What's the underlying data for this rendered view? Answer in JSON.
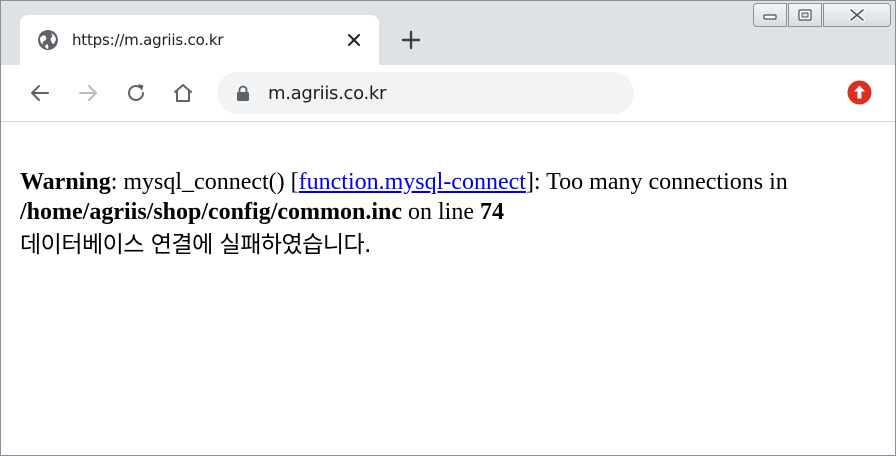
{
  "tab": {
    "title": "https://m.agriis.co.kr"
  },
  "address_bar": {
    "url": "m.agriis.co.kr"
  },
  "page": {
    "warning_label": "Warning",
    "text_before_link": ": mysql_connect() [",
    "link_text": "function.mysql-connect",
    "text_after_link": "]: Too many connections in",
    "file_path": "/home/agriis/shop/config/common.inc",
    "line_text": " on line ",
    "line_number": "74",
    "korean_message": "데이터베이스 연결에 실패하였습니다."
  },
  "colors": {
    "tabstrip": "#dee1e6",
    "omnibox": "#f1f3f4",
    "link": "#0000ee",
    "extension_badge": "#d93025"
  },
  "icons": {
    "favicon": "globe-icon",
    "tab_close": "close-icon",
    "new_tab": "plus-icon",
    "back": "arrow-left-icon",
    "forward": "arrow-right-icon",
    "reload": "reload-icon",
    "home": "home-icon",
    "secure": "lock-icon",
    "extension": "update-arrow-icon"
  }
}
